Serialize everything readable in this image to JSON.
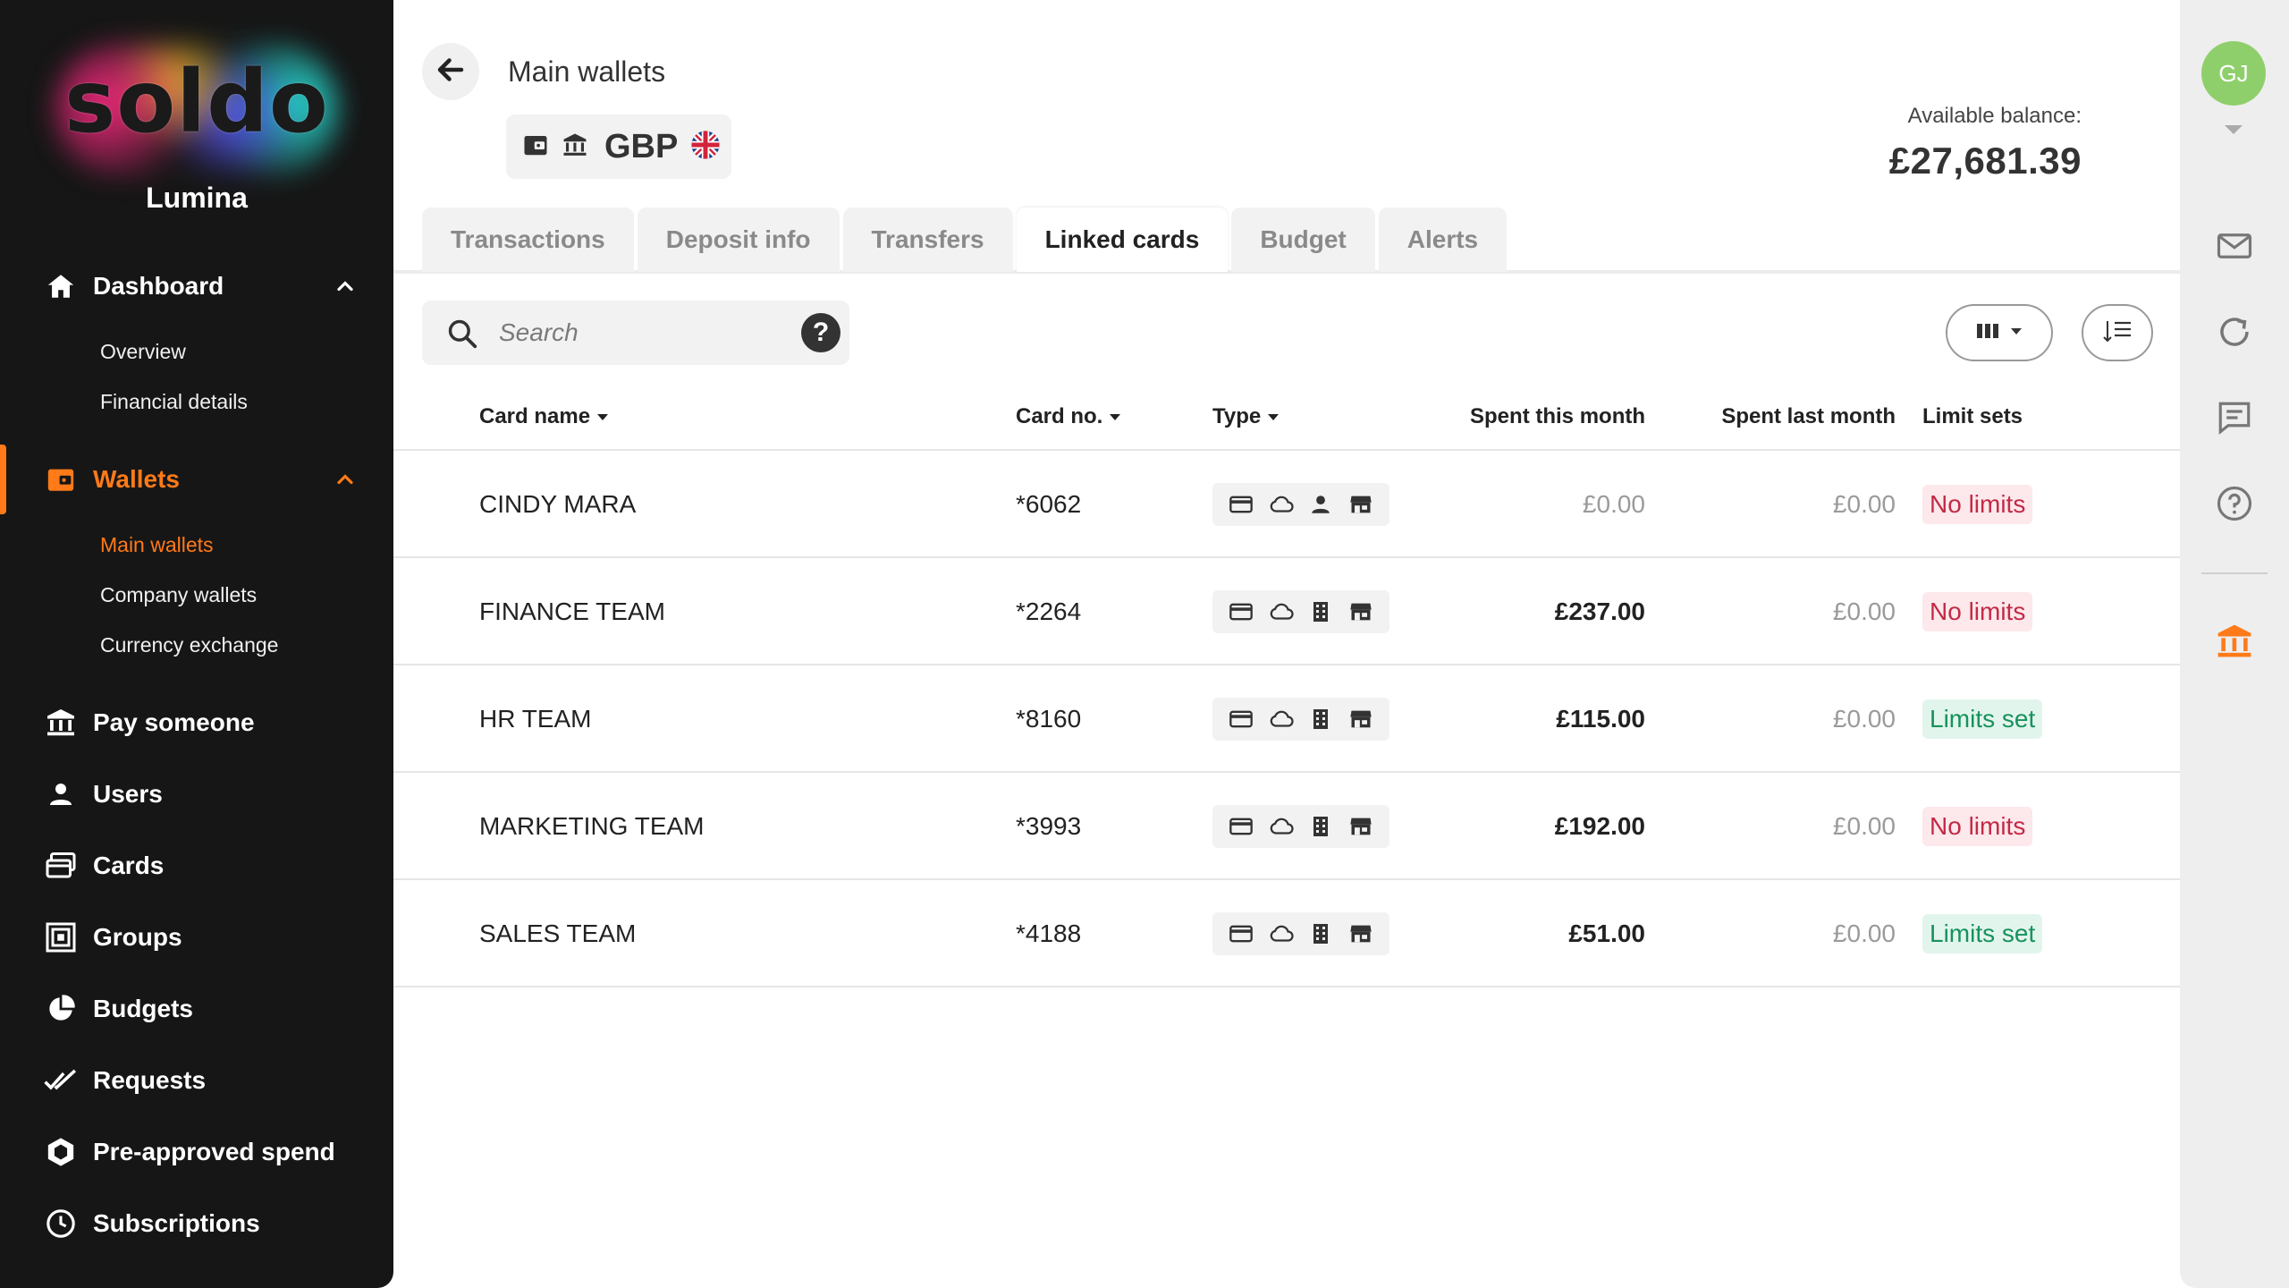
{
  "sidebar": {
    "logo_text": "soldo",
    "company": "Lumina",
    "nav": {
      "dashboard": "Dashboard",
      "overview": "Overview",
      "financial_details": "Financial details",
      "wallets": "Wallets",
      "main_wallets": "Main wallets",
      "company_wallets": "Company wallets",
      "currency_exchange": "Currency exchange",
      "pay_someone": "Pay someone",
      "users": "Users",
      "cards": "Cards",
      "groups": "Groups",
      "budgets": "Budgets",
      "requests": "Requests",
      "pre_approved": "Pre-approved spend",
      "subscriptions": "Subscriptions"
    }
  },
  "header": {
    "title": "Main wallets",
    "currency": "GBP",
    "balance_label": "Available balance:",
    "balance_value": "£27,681.39"
  },
  "tabs": [
    "Transactions",
    "Deposit info",
    "Transfers",
    "Linked cards",
    "Budget",
    "Alerts"
  ],
  "active_tab": "Linked cards",
  "search": {
    "placeholder": "Search",
    "help": "?"
  },
  "table": {
    "headers": {
      "card_name": "Card name",
      "card_no": "Card no.",
      "type": "Type",
      "spent_this_month": "Spent this month",
      "spent_last_month": "Spent last month",
      "limit_sets": "Limit sets"
    },
    "rows": [
      {
        "name": "CINDY MARA",
        "number": "*6062",
        "spent_this": "£0.00",
        "spent_last": "£0.00",
        "limit": "No limits",
        "owner_icon": "person-icon"
      },
      {
        "name": "FINANCE TEAM",
        "number": "*2264",
        "spent_this": "£237.00",
        "spent_last": "£0.00",
        "limit": "No limits",
        "owner_icon": "building-icon"
      },
      {
        "name": "HR TEAM",
        "number": "*8160",
        "spent_this": "£115.00",
        "spent_last": "£0.00",
        "limit": "Limits set",
        "owner_icon": "building-icon"
      },
      {
        "name": "MARKETING TEAM",
        "number": "*3993",
        "spent_this": "£192.00",
        "spent_last": "£0.00",
        "limit": "No limits",
        "owner_icon": "building-icon"
      },
      {
        "name": "SALES TEAM",
        "number": "*4188",
        "spent_this": "£51.00",
        "spent_last": "£0.00",
        "limit": "Limits set",
        "owner_icon": "building-icon"
      }
    ]
  },
  "rail": {
    "avatar_initials": "GJ"
  },
  "colors": {
    "accent": "#ff7a18",
    "sidebar_bg": "#161616",
    "no_limit_text": "#c22a45",
    "no_limit_bg": "#fde8ec",
    "limit_set_text": "#17925d",
    "limit_set_bg": "#e2f5ec",
    "avatar": "#8fcf6b"
  }
}
